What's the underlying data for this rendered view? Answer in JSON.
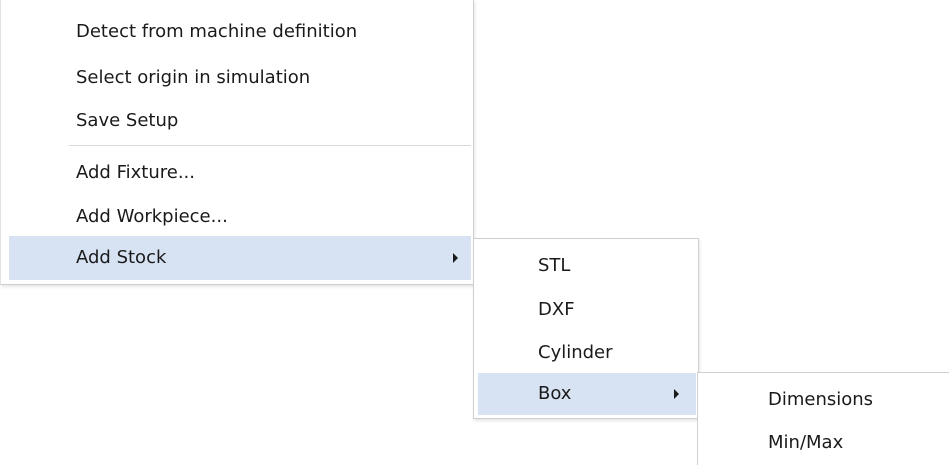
{
  "main_menu": {
    "items": [
      {
        "label": "Detect from machine definition"
      },
      {
        "label": "Select origin in simulation"
      },
      {
        "label": "Save Setup"
      },
      {
        "label": "Add Fixture..."
      },
      {
        "label": "Add Workpiece..."
      },
      {
        "label": "Add Stock",
        "has_submenu": true,
        "highlighted": true
      }
    ]
  },
  "stock_submenu": {
    "items": [
      {
        "label": "STL"
      },
      {
        "label": "DXF"
      },
      {
        "label": "Cylinder"
      },
      {
        "label": "Box",
        "has_submenu": true,
        "highlighted": true
      }
    ]
  },
  "box_submenu": {
    "items": [
      {
        "label": "Dimensions"
      },
      {
        "label": "Min/Max"
      }
    ]
  },
  "colors": {
    "highlight": "#d7e2f3",
    "border": "#cfcfcf",
    "text": "#1a1a1a"
  },
  "icons": {
    "submenu_arrow": "chevron-right-icon"
  }
}
